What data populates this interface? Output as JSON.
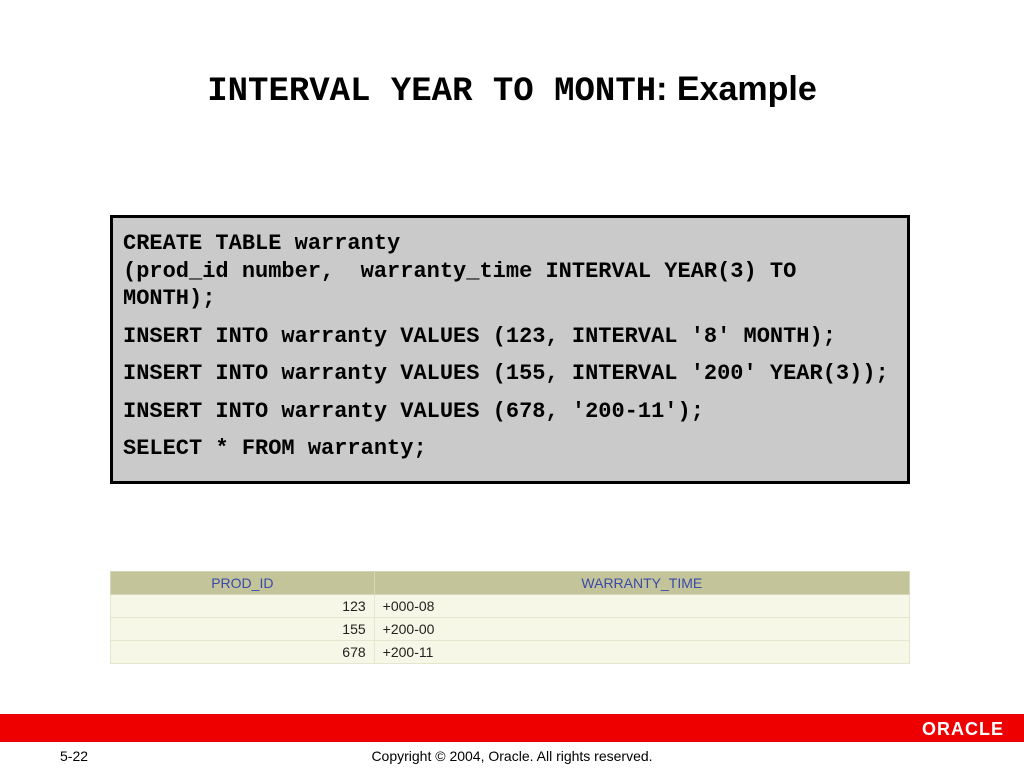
{
  "title": {
    "code_part": "INTERVAL YEAR TO MONTH",
    "rest": ": Example"
  },
  "code": {
    "lines": [
      "CREATE TABLE warranty\n(prod_id number,  warranty_time INTERVAL YEAR(3) TO MONTH);",
      "INSERT INTO warranty VALUES (123, INTERVAL '8' MONTH);",
      "INSERT INTO warranty VALUES (155, INTERVAL '200' YEAR(3));",
      "INSERT INTO warranty VALUES (678, '200-11');",
      "SELECT * FROM warranty;"
    ]
  },
  "result": {
    "headers": [
      "PROD_ID",
      "WARRANTY_TIME"
    ],
    "rows": [
      {
        "prod_id": "123",
        "warranty_time": "+000-08"
      },
      {
        "prod_id": "155",
        "warranty_time": "+200-00"
      },
      {
        "prod_id": "678",
        "warranty_time": "+200-11"
      }
    ]
  },
  "footer": {
    "page": "5-22",
    "copyright": "Copyright © 2004, Oracle.  All rights reserved.",
    "logo": "ORACLE"
  }
}
